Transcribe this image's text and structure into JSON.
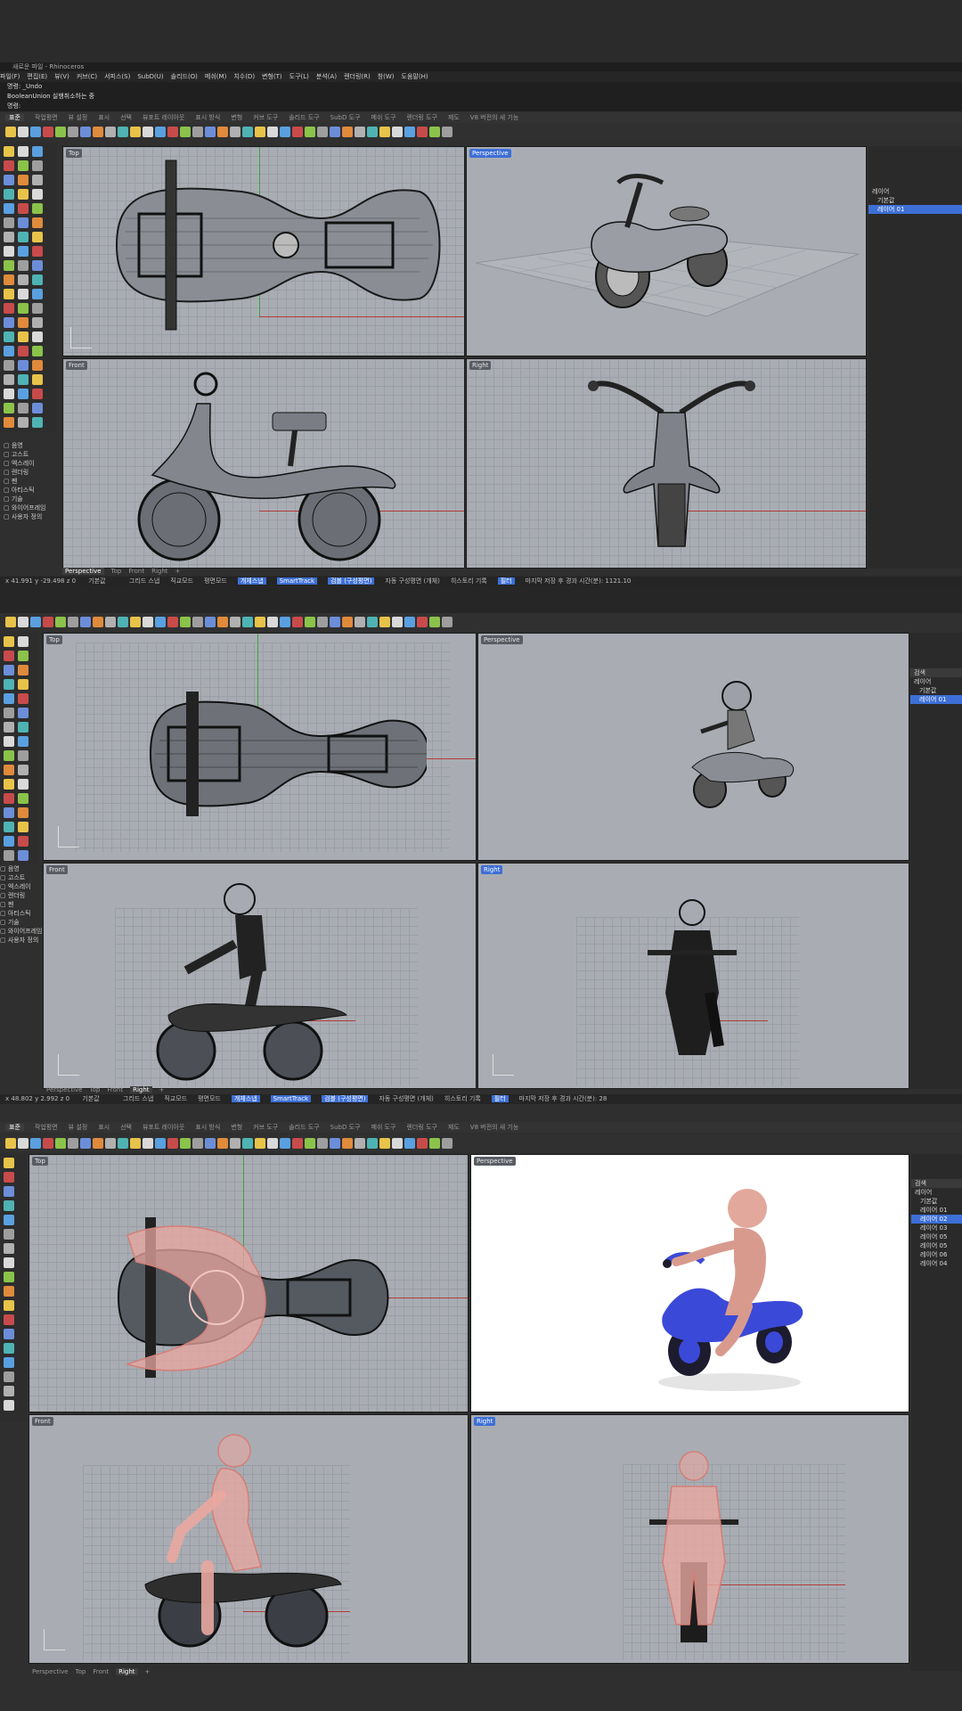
{
  "app": {
    "window_title": "새로운 파일 - Rhinoceros",
    "menu": [
      "파일(F)",
      "편집(E)",
      "뷰(V)",
      "커브(C)",
      "서피스(S)",
      "SubD(U)",
      "솔리드(O)",
      "메쉬(M)",
      "치수(D)",
      "변형(T)",
      "도구(L)",
      "분석(A)",
      "렌더링(R)",
      "창(W)",
      "도움말(H)"
    ],
    "command_history": [
      "명령: _Undo",
      "BooleanUnion 실행취소하는 중"
    ],
    "command_prompt": "명령:",
    "toolbar_tabs": [
      "표준",
      "작업평면",
      "뷰 설정",
      "표시",
      "선택",
      "뷰포트 레이아웃",
      "표시 방식",
      "변형",
      "커브 도구",
      "솔리드 도구",
      "SubD 도구",
      "메쉬 도구",
      "렌더링 도구",
      "제도",
      "V8 버전의 새 기능"
    ]
  },
  "panels": [
    {
      "viewports": [
        {
          "label": "Top",
          "selected": false
        },
        {
          "label": "Perspective",
          "selected": true
        },
        {
          "label": "Front",
          "selected": false
        },
        {
          "label": "Right",
          "selected": false
        }
      ],
      "viewport_tabs": [
        "Perspective",
        "Top",
        "Front",
        "Right"
      ],
      "active_tab": "Perspective",
      "layers_title": "레이어",
      "layers": [
        {
          "name": "기본값",
          "selected": false
        },
        {
          "name": "레이어 01",
          "selected": true
        }
      ],
      "status": [
        "그리드 스냅",
        "직교모드",
        "평면모드",
        "개체스냅",
        "SmartTrack",
        "검볼 (구성평면)",
        "자동 구성평면 (개체)",
        "히스토리 기록",
        "필터",
        "마지막 저장 후 경과 시간(분): 1121.10"
      ],
      "status_coord": "x 41.991  y -29.498  z 0",
      "status_layer": "기본값"
    },
    {
      "viewports": [
        {
          "label": "Top",
          "selected": false
        },
        {
          "label": "Perspective",
          "selected": false
        },
        {
          "label": "Front",
          "selected": false
        },
        {
          "label": "Right",
          "selected": true
        }
      ],
      "viewport_tabs": [
        "Perspective",
        "Top",
        "Front",
        "Right"
      ],
      "active_tab": "Right",
      "layers_title": "레이어",
      "layers": [
        {
          "name": "기본값",
          "selected": false
        },
        {
          "name": "레이어 01",
          "selected": true
        }
      ],
      "status": [
        "그리드 스냅",
        "직교모드",
        "평면모드",
        "개체스냅",
        "SmartTrack",
        "검볼 (구성평면)",
        "자동 구성평면 (개체)",
        "히스토리 기록",
        "필터",
        "마지막 저장 후 경과 시간(분): 28"
      ],
      "status_coord": "x 48.802  y 2.992  z 0",
      "status_layer": "기본값",
      "search_placeholder": "검색"
    },
    {
      "viewports": [
        {
          "label": "Top",
          "selected": false
        },
        {
          "label": "Perspective",
          "selected": false
        },
        {
          "label": "Front",
          "selected": false
        },
        {
          "label": "Right",
          "selected": true
        }
      ],
      "viewport_tabs": [
        "Perspective",
        "Top",
        "Front",
        "Right"
      ],
      "active_tab": "Right",
      "layers_title": "레이어",
      "layers": [
        {
          "name": "기본값",
          "selected": false
        },
        {
          "name": "레이어 01",
          "selected": false
        },
        {
          "name": "레이어 02",
          "selected": true
        },
        {
          "name": "레이어 03",
          "selected": false
        },
        {
          "name": "레이어 05",
          "selected": false
        },
        {
          "name": "레이어 05",
          "selected": false
        },
        {
          "name": "레이어 06",
          "selected": false
        },
        {
          "name": "레이어 04",
          "selected": false
        }
      ],
      "search_placeholder": "검색"
    }
  ],
  "display_modes": [
    "음영",
    "고스트",
    "엑스레이",
    "렌더링",
    "펜",
    "아티스틱",
    "기술",
    "와이어프레임",
    "사용자 정의"
  ],
  "colors": {
    "accent": "#3d6fd6",
    "viewport_bg": "#a9adb3",
    "ui_dark": "#2b2b2b",
    "ghost_pink": "#e9a7a0",
    "bike_blue": "#3b49d8"
  }
}
